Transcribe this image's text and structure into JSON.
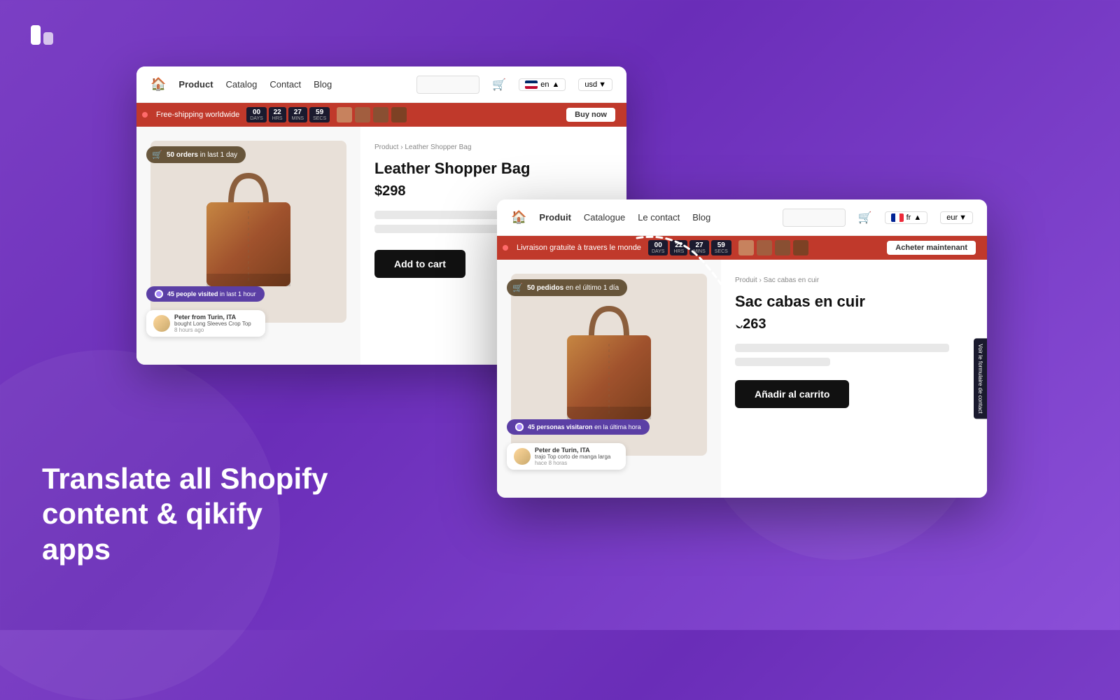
{
  "logo": {
    "alt": "qikify logo"
  },
  "tagline": {
    "line1": "Translate all Shopify",
    "line2": "content & qikify apps"
  },
  "browser_en": {
    "navbar": {
      "home_icon": "🏠",
      "links": [
        "Product",
        "Catalog",
        "Contact",
        "Blog"
      ],
      "lang": "en",
      "currency": "usd"
    },
    "promo_bar": {
      "text": "Free-shipping worldwide",
      "countdown": [
        {
          "value": "00",
          "label": "DAYS"
        },
        {
          "value": "22",
          "label": "HRS"
        },
        {
          "value": "27",
          "label": "MINS"
        },
        {
          "value": "59",
          "label": "SECS"
        }
      ],
      "buy_now": "Buy now"
    },
    "breadcrumb": "Product › Leather Shopper Bag",
    "product_title": "Leather Shopper Bag",
    "product_price": "$298",
    "add_to_cart": "Add to cart",
    "orders_badge": {
      "count": "50 orders",
      "period": "in last 1 day"
    },
    "visitors_badge": {
      "count": "45 people visited",
      "period": "in last 1 hour"
    },
    "buyer_badge": {
      "name": "Peter from Turin, ITA",
      "bought": "bought Long Sleeves Crop Top",
      "time": "8 hours ago"
    }
  },
  "browser_fr": {
    "navbar": {
      "home_icon": "🏠",
      "links": [
        "Produit",
        "Catalogue",
        "Le contact",
        "Blog"
      ],
      "lang": "fr",
      "currency": "eur"
    },
    "promo_bar": {
      "text": "Livraison gratuite à travers le monde",
      "countdown": [
        {
          "value": "00",
          "label": "DAYS"
        },
        {
          "value": "22",
          "label": "HRS"
        },
        {
          "value": "27",
          "label": "MINS"
        },
        {
          "value": "59",
          "label": "SECS"
        }
      ],
      "buy_now": "Acheter maintenant"
    },
    "breadcrumb": "Produit › Sac cabas en cuir",
    "product_title": "Sac cabas en cuir",
    "product_price": "€263",
    "add_to_cart": "Añadir al carrito",
    "orders_badge": {
      "count": "50 pedidos",
      "period": "en el último 1 día"
    },
    "visitors_badge": {
      "count": "45 personas visitaron",
      "period": "en la última hora"
    },
    "buyer_badge": {
      "name": "Peter de Turin, ITA",
      "bought": "trajo Top corto de manga larga",
      "time": "hace 8 horas"
    },
    "sidebar_contact": "Voir le formulaire de contact"
  }
}
